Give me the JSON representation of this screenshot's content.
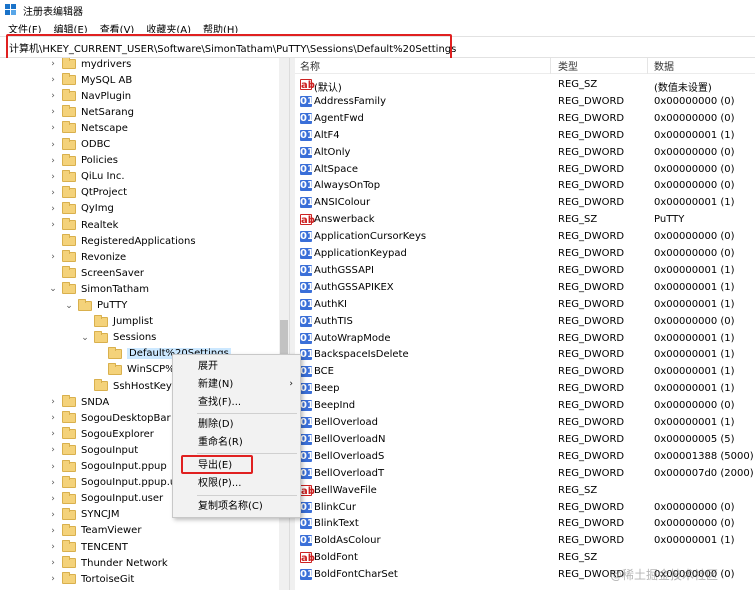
{
  "window": {
    "title": "注册表编辑器"
  },
  "menu": [
    "文件(F)",
    "编辑(E)",
    "查看(V)",
    "收藏夹(A)",
    "帮助(H)"
  ],
  "address": {
    "path": "计算机\\HKEY_CURRENT_USER\\Software\\SimonTatham\\PuTTY\\Sessions\\Default%20Settings"
  },
  "tree": {
    "items": [
      {
        "label": "mydrivers",
        "level": 0,
        "expander": "›"
      },
      {
        "label": "MySQL AB",
        "level": 0,
        "expander": "›"
      },
      {
        "label": "NavPlugin",
        "level": 0,
        "expander": "›"
      },
      {
        "label": "NetSarang",
        "level": 0,
        "expander": "›"
      },
      {
        "label": "Netscape",
        "level": 0,
        "expander": "›"
      },
      {
        "label": "ODBC",
        "level": 0,
        "expander": "›"
      },
      {
        "label": "Policies",
        "level": 0,
        "expander": "›"
      },
      {
        "label": "QiLu Inc.",
        "level": 0,
        "expander": "›"
      },
      {
        "label": "QtProject",
        "level": 0,
        "expander": "›"
      },
      {
        "label": "QyImg",
        "level": 0,
        "expander": "›"
      },
      {
        "label": "Realtek",
        "level": 0,
        "expander": "›"
      },
      {
        "label": "RegisteredApplications",
        "level": 0,
        "expander": ""
      },
      {
        "label": "Revonize",
        "level": 0,
        "expander": "›"
      },
      {
        "label": "ScreenSaver",
        "level": 0,
        "expander": ""
      },
      {
        "label": "SimonTatham",
        "level": 0,
        "expander": "⌄"
      },
      {
        "label": "PuTTY",
        "level": 1,
        "expander": "⌄"
      },
      {
        "label": "Jumplist",
        "level": 2,
        "expander": ""
      },
      {
        "label": "Sessions",
        "level": 2,
        "expander": "⌄"
      },
      {
        "label": "Default%20Settings",
        "level": 3,
        "expander": "",
        "selected": true
      },
      {
        "label": "WinSCP%20",
        "level": 3,
        "expander": ""
      },
      {
        "label": "SshHostKeys",
        "level": 2,
        "expander": ""
      },
      {
        "label": "SNDA",
        "level": 0,
        "expander": "›"
      },
      {
        "label": "SogouDesktopBar",
        "level": 0,
        "expander": "›"
      },
      {
        "label": "SogouExplorer",
        "level": 0,
        "expander": "›"
      },
      {
        "label": "SogouInput",
        "level": 0,
        "expander": "›"
      },
      {
        "label": "SogouInput.ppup",
        "level": 0,
        "expander": "›"
      },
      {
        "label": "SogouInput.ppup.us",
        "level": 0,
        "expander": "›"
      },
      {
        "label": "SogouInput.user",
        "level": 0,
        "expander": "›"
      },
      {
        "label": "SYNCJM",
        "level": 0,
        "expander": "›"
      },
      {
        "label": "TeamViewer",
        "level": 0,
        "expander": "›"
      },
      {
        "label": "TENCENT",
        "level": 0,
        "expander": "›"
      },
      {
        "label": "Thunder Network",
        "level": 0,
        "expander": "›"
      },
      {
        "label": "TortoiseGit",
        "level": 0,
        "expander": "›"
      }
    ]
  },
  "list": {
    "headers": {
      "name": "名称",
      "type": "类型",
      "data": "数据"
    },
    "rows": [
      {
        "icon": "ab",
        "name": "(默认)",
        "type": "REG_SZ",
        "data": "(数值未设置)"
      },
      {
        "icon": "dw",
        "name": "AddressFamily",
        "type": "REG_DWORD",
        "data": "0x00000000 (0)"
      },
      {
        "icon": "dw",
        "name": "AgentFwd",
        "type": "REG_DWORD",
        "data": "0x00000000 (0)"
      },
      {
        "icon": "dw",
        "name": "AltF4",
        "type": "REG_DWORD",
        "data": "0x00000001 (1)"
      },
      {
        "icon": "dw",
        "name": "AltOnly",
        "type": "REG_DWORD",
        "data": "0x00000000 (0)"
      },
      {
        "icon": "dw",
        "name": "AltSpace",
        "type": "REG_DWORD",
        "data": "0x00000000 (0)"
      },
      {
        "icon": "dw",
        "name": "AlwaysOnTop",
        "type": "REG_DWORD",
        "data": "0x00000000 (0)"
      },
      {
        "icon": "dw",
        "name": "ANSIColour",
        "type": "REG_DWORD",
        "data": "0x00000001 (1)"
      },
      {
        "icon": "ab",
        "name": "Answerback",
        "type": "REG_SZ",
        "data": "PuTTY"
      },
      {
        "icon": "dw",
        "name": "ApplicationCursorKeys",
        "type": "REG_DWORD",
        "data": "0x00000000 (0)"
      },
      {
        "icon": "dw",
        "name": "ApplicationKeypad",
        "type": "REG_DWORD",
        "data": "0x00000000 (0)"
      },
      {
        "icon": "dw",
        "name": "AuthGSSAPI",
        "type": "REG_DWORD",
        "data": "0x00000001 (1)"
      },
      {
        "icon": "dw",
        "name": "AuthGSSAPIKEX",
        "type": "REG_DWORD",
        "data": "0x00000001 (1)"
      },
      {
        "icon": "dw",
        "name": "AuthKI",
        "type": "REG_DWORD",
        "data": "0x00000001 (1)"
      },
      {
        "icon": "dw",
        "name": "AuthTIS",
        "type": "REG_DWORD",
        "data": "0x00000000 (0)"
      },
      {
        "icon": "dw",
        "name": "AutoWrapMode",
        "type": "REG_DWORD",
        "data": "0x00000001 (1)"
      },
      {
        "icon": "dw",
        "name": "BackspaceIsDelete",
        "type": "REG_DWORD",
        "data": "0x00000001 (1)"
      },
      {
        "icon": "dw",
        "name": "BCE",
        "type": "REG_DWORD",
        "data": "0x00000001 (1)"
      },
      {
        "icon": "dw",
        "name": "Beep",
        "type": "REG_DWORD",
        "data": "0x00000001 (1)"
      },
      {
        "icon": "dw",
        "name": "BeepInd",
        "type": "REG_DWORD",
        "data": "0x00000000 (0)"
      },
      {
        "icon": "dw",
        "name": "BellOverload",
        "type": "REG_DWORD",
        "data": "0x00000001 (1)"
      },
      {
        "icon": "dw",
        "name": "BellOverloadN",
        "type": "REG_DWORD",
        "data": "0x00000005 (5)"
      },
      {
        "icon": "dw",
        "name": "BellOverloadS",
        "type": "REG_DWORD",
        "data": "0x00001388 (5000)"
      },
      {
        "icon": "dw",
        "name": "BellOverloadT",
        "type": "REG_DWORD",
        "data": "0x000007d0 (2000)"
      },
      {
        "icon": "ab",
        "name": "BellWaveFile",
        "type": "REG_SZ",
        "data": ""
      },
      {
        "icon": "dw",
        "name": "BlinkCur",
        "type": "REG_DWORD",
        "data": "0x00000000 (0)"
      },
      {
        "icon": "dw",
        "name": "BlinkText",
        "type": "REG_DWORD",
        "data": "0x00000000 (0)"
      },
      {
        "icon": "dw",
        "name": "BoldAsColour",
        "type": "REG_DWORD",
        "data": "0x00000001 (1)"
      },
      {
        "icon": "ab",
        "name": "BoldFont",
        "type": "REG_SZ",
        "data": ""
      },
      {
        "icon": "dw",
        "name": "BoldFontCharSet",
        "type": "REG_DWORD",
        "data": "0x00000000 (0)"
      }
    ]
  },
  "context_menu": {
    "items": [
      {
        "label": "展开",
        "submenu": false
      },
      {
        "label": "新建(N)",
        "submenu": true
      },
      {
        "label": "查找(F)...",
        "submenu": false
      },
      {
        "label": "删除(D)",
        "submenu": false
      },
      {
        "label": "重命名(R)",
        "submenu": false
      },
      {
        "label": "导出(E)",
        "submenu": false,
        "highlighted": true
      },
      {
        "label": "权限(P)...",
        "submenu": false
      },
      {
        "label": "复制项名称(C)",
        "submenu": false
      }
    ]
  },
  "watermark": "@稀土掘金技术社区",
  "colors": {
    "highlight_box": "#e02020",
    "selection": "#cce8ff",
    "dword_icon": "#3a6fd8",
    "string_icon": "#cc2222",
    "folder": "#f4d27a"
  }
}
